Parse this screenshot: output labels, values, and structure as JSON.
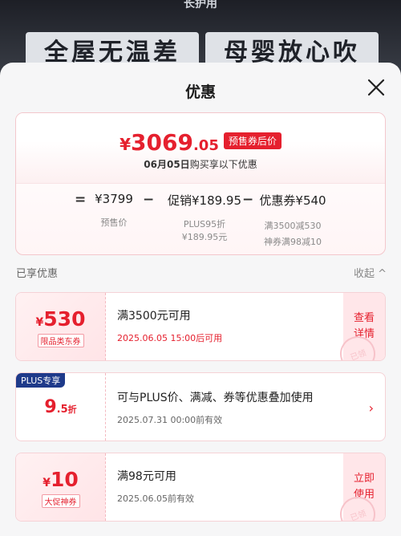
{
  "background": {
    "top_text": "长护用",
    "slogan_left": "全屋无温差",
    "slogan_right": "母婴放心吹"
  },
  "sheet": {
    "title": "优惠",
    "close_icon": "close-icon"
  },
  "summary": {
    "currency": "¥",
    "price_int": "3069",
    "price_dec": ".05",
    "tag": "预售券后价",
    "date_prefix": "06月05日",
    "date_suffix": "购买享以下优惠",
    "formula": {
      "eq": "=",
      "base": "¥3799",
      "base_sub": "预售价",
      "minus1": "−",
      "promo": "促销¥189.95",
      "promo_sub1": "PLUS95折",
      "promo_sub2": "¥189.95元",
      "minus2": "−",
      "coupon": "优惠券¥540",
      "coupon_sub1": "满3500减530",
      "coupon_sub2": "神券满98减10"
    }
  },
  "section": {
    "title": "已享优惠",
    "collapse": "收起 ^"
  },
  "coupons": [
    {
      "currency": "¥",
      "amount": "530",
      "label": "限品类东券",
      "condition": "满3500元可用",
      "time": "2025.06.05 15:00后可用",
      "action_line1": "查看",
      "action_line2": "详情",
      "stamp": "已领"
    },
    {
      "badge": "PLUS专享",
      "amount": "9",
      "amount_dec": ".5",
      "amount_unit": "折",
      "condition": "可与PLUS价、满减、券等优惠叠加使用",
      "time": "2025.07.31 00:00前有效",
      "chevron": "›"
    },
    {
      "currency": "¥",
      "amount": "10",
      "label": "大促神券",
      "condition": "满98元可用",
      "time": "2025.06.05前有效",
      "action_line1": "立即",
      "action_line2": "使用",
      "stamp": "已领"
    }
  ],
  "colors": {
    "accent": "#e5202e",
    "plus": "#1e3a8a"
  }
}
